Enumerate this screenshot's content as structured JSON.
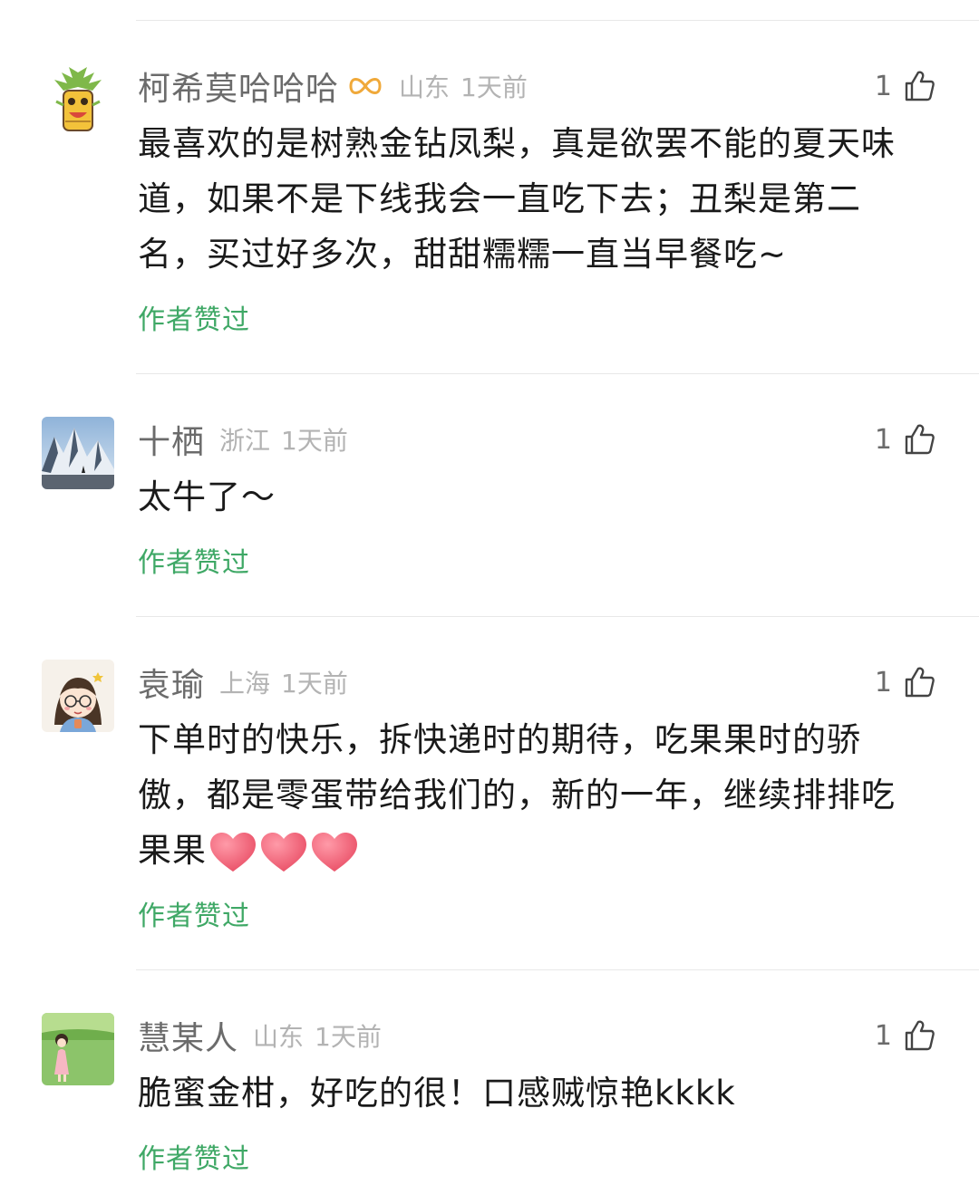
{
  "comments": [
    {
      "username": "柯希莫哈哈哈",
      "region": "山东",
      "time": "1天前",
      "likes": "1",
      "lines": [
        "最喜欢的是树熟金钻凤梨，真是欲罢不能的夏天味",
        "道，如果不是下线我会一直吃下去；丑梨是第二",
        "名，买过好多次，甜甜糯糯一直当早餐吃~"
      ],
      "author_liked": "作者赞过"
    },
    {
      "username": "十栖",
      "region": "浙江",
      "time": "1天前",
      "likes": "1",
      "lines": [
        "太牛了～"
      ],
      "author_liked": "作者赞过"
    },
    {
      "username": "袁瑜",
      "region": "上海",
      "time": "1天前",
      "likes": "1",
      "lines": [
        "下单时的快乐，拆快递时的期待，吃果果时的骄",
        "傲，都是零蛋带给我们的，新的一年，继续排排吃",
        "果果"
      ],
      "author_liked": "作者赞过"
    },
    {
      "username": "慧某人",
      "region": "山东",
      "time": "1天前",
      "likes": "1",
      "lines": [
        "脆蜜金柑，好吃的很！口感贼惊艳kkkk"
      ],
      "author_liked": "作者赞过"
    }
  ],
  "icons": {
    "like": "thumbs-up-outline-icon",
    "badge": "infinity-badge-icon",
    "heart": "red-heart-emoji"
  },
  "colors": {
    "author_liked": "#3fa866",
    "username": "#6b6b6b",
    "meta": "#b3b3b3",
    "text": "#1a1a1a",
    "heart": "#ef5b6e",
    "badge": "#f0a93a"
  }
}
